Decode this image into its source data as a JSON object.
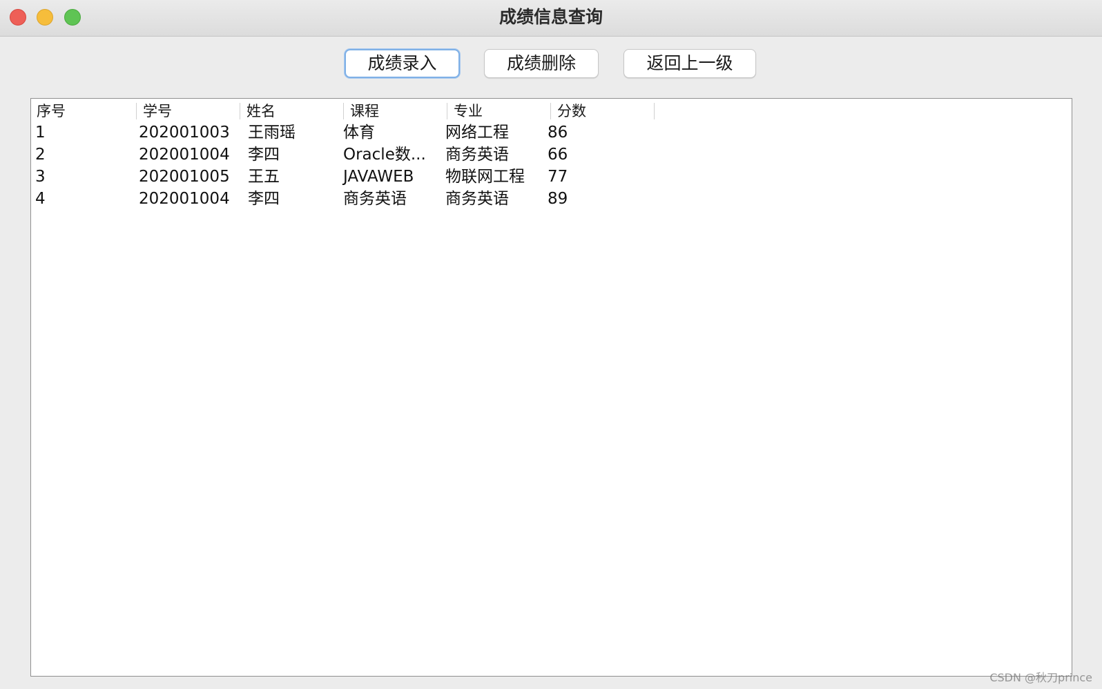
{
  "window": {
    "title": "成绩信息查询"
  },
  "toolbar": {
    "enter_label": "成绩录入",
    "delete_label": "成绩删除",
    "back_label": "返回上一级"
  },
  "table": {
    "columns": [
      "序号",
      "学号",
      "姓名",
      "课程",
      "专业",
      "分数"
    ],
    "rows": [
      [
        "1",
        "202001003",
        "王雨瑶",
        "体育",
        "网络工程",
        "86"
      ],
      [
        "2",
        "202001004",
        "李四",
        "Oracle数...",
        "商务英语",
        "66"
      ],
      [
        "3",
        "202001005",
        "王五",
        "JAVAWEB",
        "物联网工程",
        "77"
      ],
      [
        "4",
        "202001004",
        "李四",
        "商务英语",
        "商务英语",
        "89"
      ]
    ]
  },
  "watermark": "CSDN @秋刀prince",
  "colors": {
    "close": "#ee5f57",
    "minimize": "#f6bd3b",
    "maximize": "#5fc454",
    "focus_ring": "#7fb0e6"
  }
}
